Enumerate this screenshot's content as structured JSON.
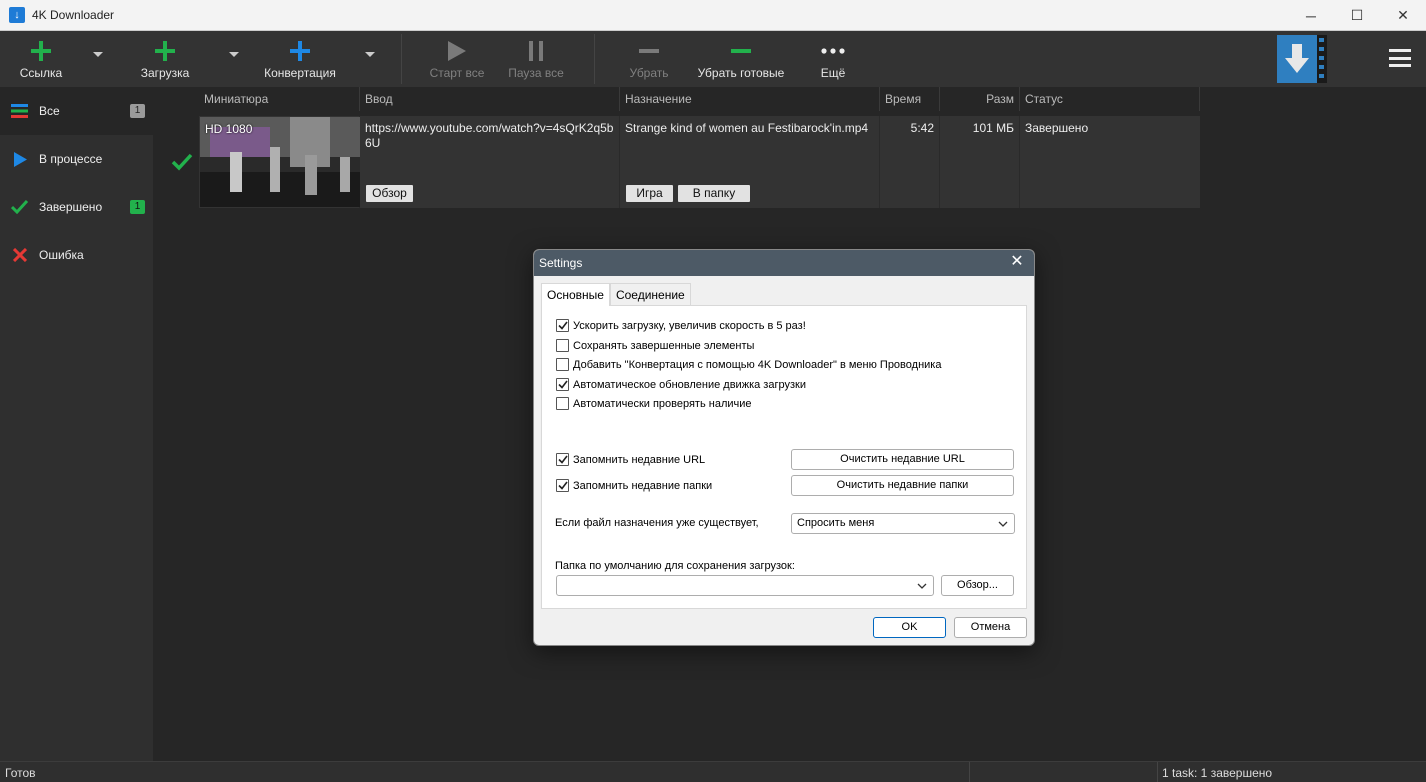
{
  "window": {
    "title": "4K Downloader",
    "controls": {
      "minimize": "─",
      "maximize": "☐",
      "close": "✕"
    }
  },
  "toolbar": {
    "link": "Ссылка",
    "download": "Загрузка",
    "convert": "Конвертация",
    "start_all": "Старт все",
    "pause_all": "Пауза все",
    "remove": "Убрать",
    "remove_done": "Убрать готовые",
    "more": "Ещё"
  },
  "sidebar": {
    "items": [
      {
        "label": "Все",
        "badge": "1",
        "icon": "list-icon"
      },
      {
        "label": "В процессе",
        "badge": "",
        "icon": "play-icon"
      },
      {
        "label": "Завершено",
        "badge": "1",
        "icon": "check-icon"
      },
      {
        "label": "Ошибка",
        "badge": "",
        "icon": "x-icon"
      }
    ]
  },
  "table": {
    "columns": [
      "Миниатюра",
      "Ввод",
      "Назначение",
      "Время",
      "Разм",
      "Статус"
    ],
    "rows": [
      {
        "thumb_label": "HD 1080",
        "input": "https://www.youtube.com/watch?v=4sQrK2q5b6U",
        "destination": "Strange kind of women au Festibarock'in.mp4",
        "time": "5:42",
        "size": "101 МБ",
        "status": "Завершено",
        "browse_btn": "Обзор",
        "play_btn": "Игра",
        "folder_btn": "В папку"
      }
    ]
  },
  "statusbar": {
    "left": "Готов",
    "right": "1 task: 1 завершено"
  },
  "dialog": {
    "title": "Settings",
    "tabs": [
      "Основные",
      "Соединение"
    ],
    "checkboxes": [
      {
        "label": "Ускорить загрузку, увеличив скорость в 5 раз!",
        "checked": true
      },
      {
        "label": "Сохранять завершенные элементы",
        "checked": false
      },
      {
        "label": "Добавить \"Конвертация с помощью 4K Downloader\" в меню Проводника",
        "checked": false
      },
      {
        "label": "Автоматическое обновление движка загрузки",
        "checked": true
      },
      {
        "label": "Автоматически проверять наличие",
        "checked": false
      }
    ],
    "remember_url": {
      "label": "Запомнить недавние URL",
      "checked": true,
      "button": "Очистить недавние URL"
    },
    "remember_folders": {
      "label": "Запомнить недавние папки",
      "checked": true,
      "button": "Очистить недавние папки"
    },
    "exists_label": "Если файл назначения уже существует,",
    "exists_value": "Спросить меня",
    "folder_label": "Папка по умолчанию для сохранения загрузок:",
    "folder_value": "",
    "browse": "Обзор...",
    "ok": "OK",
    "cancel": "Отмена"
  },
  "colors": {
    "green": "#22b14c",
    "blue": "#1e88e5",
    "red": "#e53935",
    "brand": "#2f7fc0"
  }
}
